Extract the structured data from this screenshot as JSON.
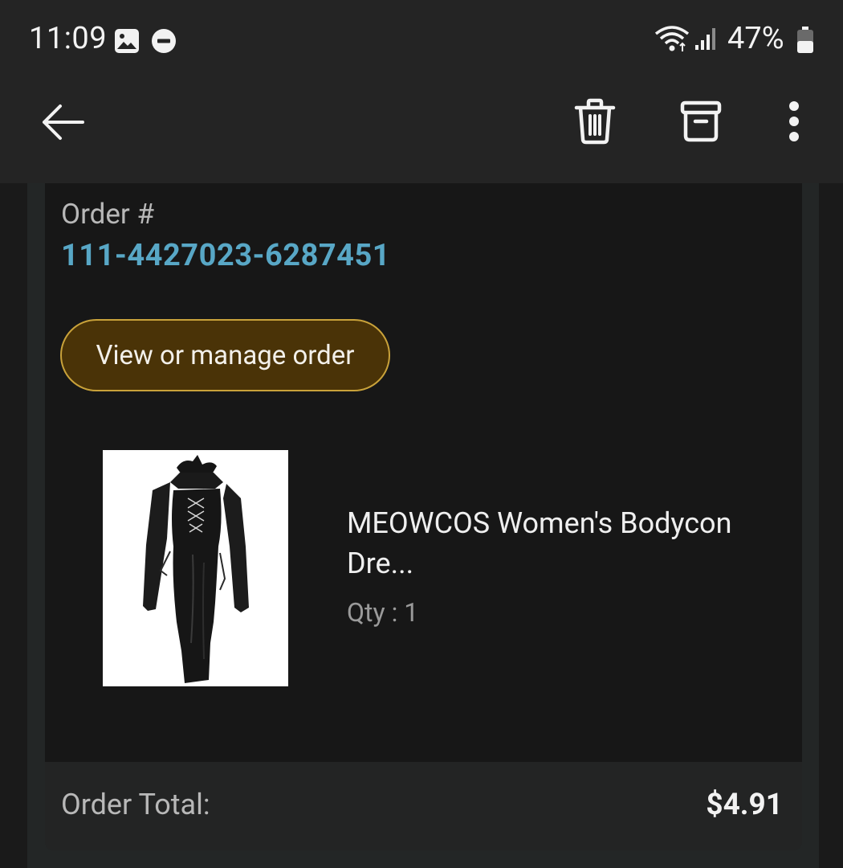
{
  "status_bar": {
    "time": "11:09",
    "battery": "47%",
    "icons": [
      "gallery-icon",
      "do-not-disturb-icon",
      "wifi-icon",
      "signal-icon",
      "battery-icon"
    ]
  },
  "app_bar": {
    "icons": [
      "back-arrow-icon",
      "delete-icon",
      "archive-icon",
      "more-options-icon"
    ]
  },
  "order": {
    "label": "Order #",
    "number": "111-4427023-6287451",
    "manage_button": "View or manage order",
    "item": {
      "title": "MEOWCOS Women's Bodycon Dre...",
      "qty": "Qty : 1"
    },
    "total_label": "Order Total:",
    "total_value": "$4.91"
  },
  "colors": {
    "link": "#58a7c6",
    "button_fill": "#4a3307",
    "button_border": "#c9a23a",
    "background": "#1c1c1c"
  }
}
